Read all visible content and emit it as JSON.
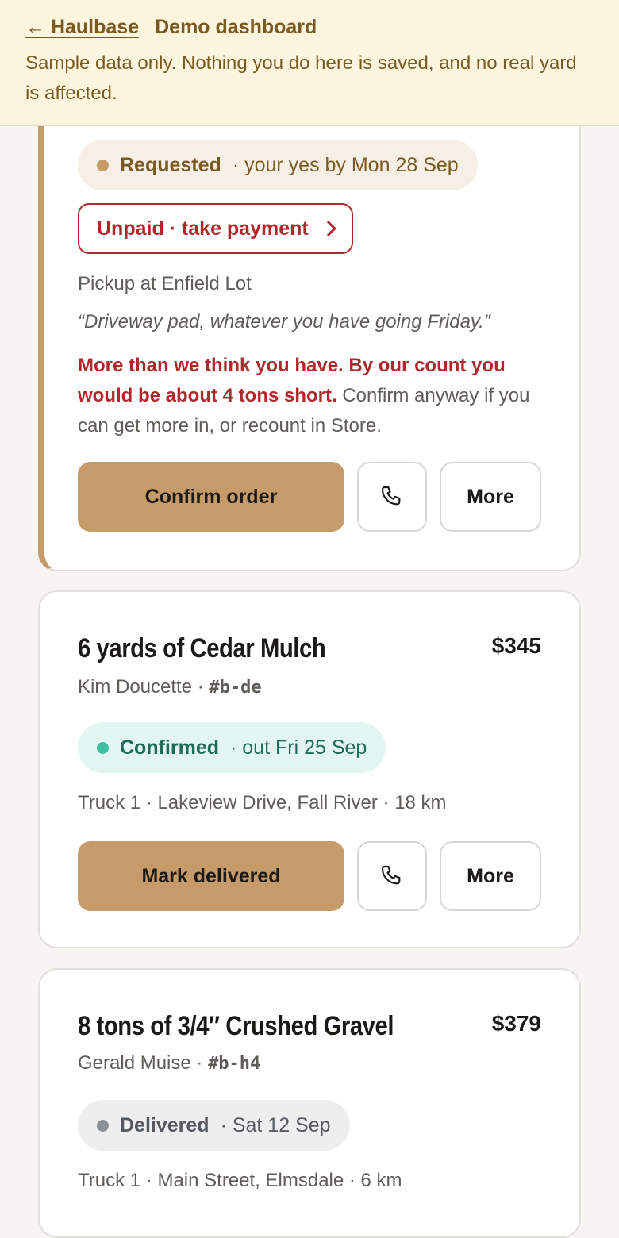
{
  "banner": {
    "back_label": "← Haulbase",
    "title": "Demo dashboard",
    "notice": "Sample data only. Nothing you do here is saved, and no real yard is affected."
  },
  "orders": [
    {
      "status": "Requested",
      "status_detail": "· your yes by Mon 28 Sep",
      "payment_label": "Unpaid · take payment",
      "pickup": "Pickup at Enfield Lot",
      "note": "“Driveway pad, whatever you have going Friday.”",
      "warning_strong": "More than we think you have. By our count you would be about 4 tons short.",
      "warning_rest": " Confirm anyway if you can get more in, or recount in Store.",
      "primary_action": "Confirm order",
      "more_label": "More"
    },
    {
      "title": "6 yards of Cedar Mulch",
      "price": "$345",
      "customer": "Kim Doucette · ",
      "ref": "#b-de",
      "status": "Confirmed",
      "status_detail": "· out Fri 25 Sep",
      "route": "Truck 1 · Lakeview Drive, Fall River · 18 km",
      "primary_action": "Mark delivered",
      "more_label": "More"
    },
    {
      "title": "8 tons of 3/4″ Crushed Gravel",
      "price": "$379",
      "customer": "Gerald Muise · ",
      "ref": "#b-h4",
      "status": "Delivered",
      "status_detail": "· Sat 12 Sep",
      "route": "Truck 1 · Main Street, Elmsdale · 6 km"
    }
  ],
  "colors": {
    "accent": "#c69b69",
    "warning": "#b0282c",
    "confirmed": "#3dbfa3",
    "banner_bg": "#fdf5dd"
  }
}
